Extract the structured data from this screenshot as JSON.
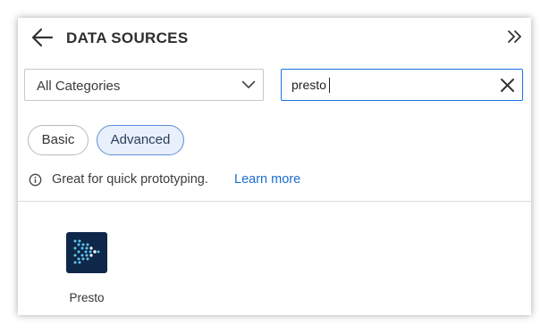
{
  "header": {
    "title": "DATA SOURCES",
    "back_icon": "arrow-left-icon",
    "collapse_icon": "double-chevron-right-icon"
  },
  "filters": {
    "category": {
      "selected": "All Categories",
      "icon": "chevron-down-icon"
    },
    "search": {
      "value": "presto",
      "clear_icon": "close-icon"
    }
  },
  "tabs": [
    {
      "label": "Basic",
      "selected": false
    },
    {
      "label": "Advanced",
      "selected": true
    }
  ],
  "info": {
    "icon": "info-icon",
    "text": "Great for quick prototyping.",
    "link_label": "Learn more"
  },
  "results": [
    {
      "label": "Presto",
      "icon": "presto-logo-icon"
    }
  ],
  "colors": {
    "accent": "#1a73e8",
    "link": "#1a6dd0",
    "selected_chip_bg": "#e8f0fb",
    "presto_logo_bg": "#0f2748",
    "presto_logo_dots": "#5cc8f0"
  }
}
